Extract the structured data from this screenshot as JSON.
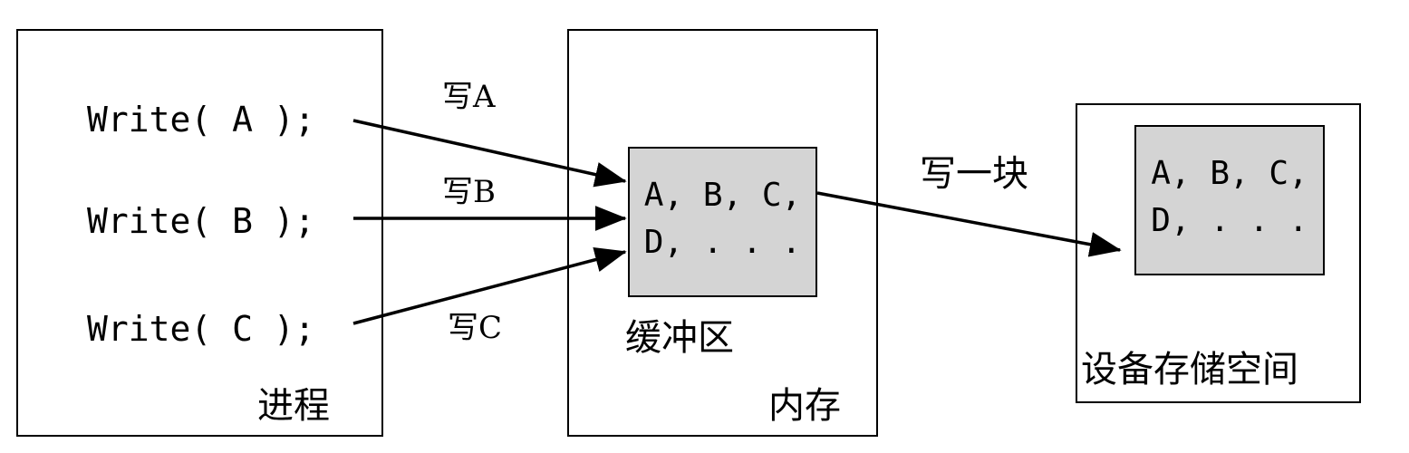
{
  "process": {
    "lines": [
      "Write( A );",
      "Write( B );",
      "Write( C );"
    ],
    "label": "进程"
  },
  "memory": {
    "label": "内存",
    "buffer_label": "缓冲区",
    "buffer_line1": "A, B, C,",
    "buffer_line2": "D, . . ."
  },
  "device": {
    "label": "设备存储空间",
    "block_line1": "A, B, C,",
    "block_line2": "D, . . ."
  },
  "arrows": {
    "write_a": "写A",
    "write_b": "写B",
    "write_c": "写C",
    "write_block": "写一块"
  }
}
